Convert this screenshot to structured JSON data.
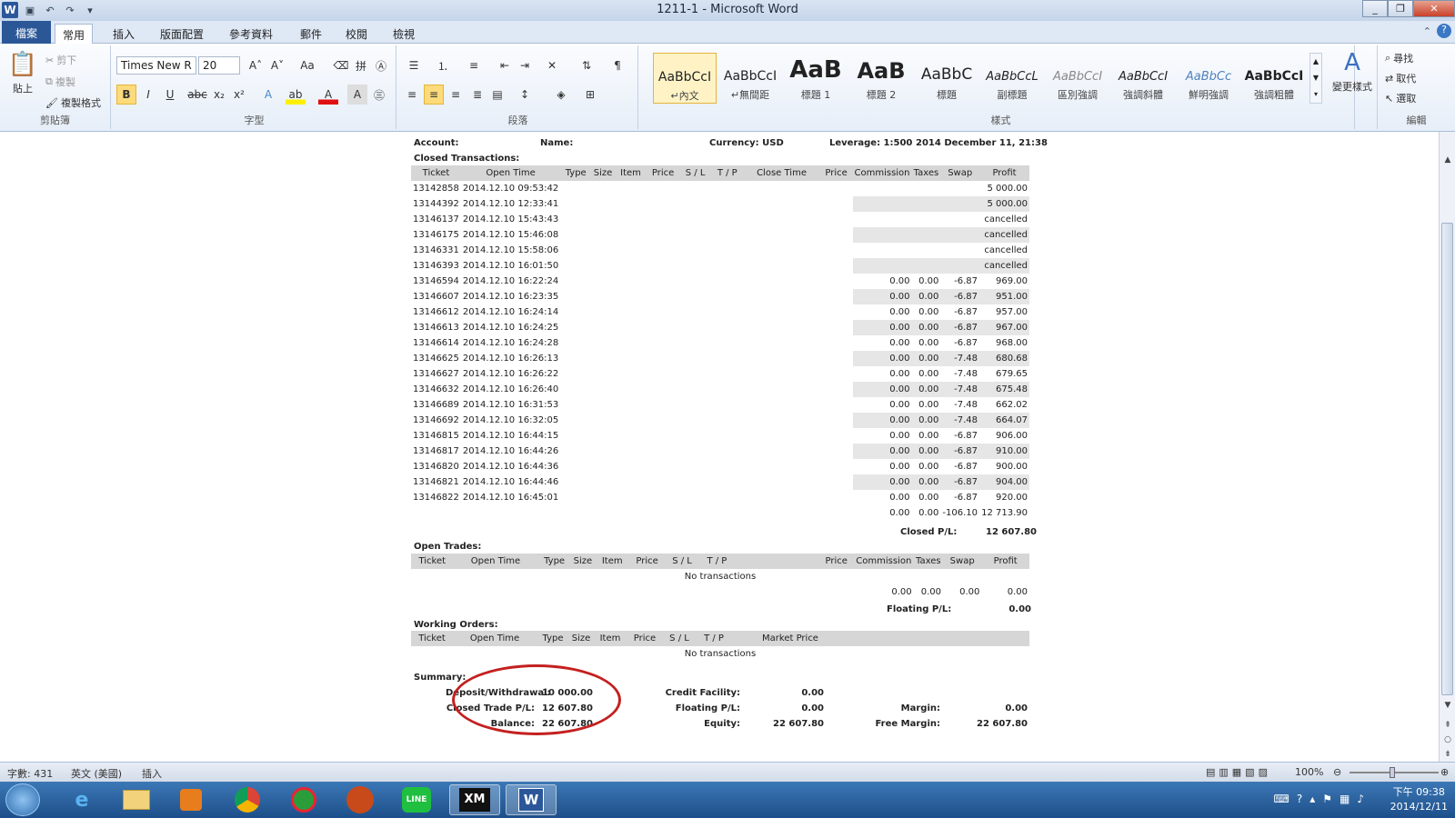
{
  "window": {
    "title": "1211-1 - Microsoft Word"
  },
  "tabs": [
    "檔案",
    "常用",
    "插入",
    "版面配置",
    "參考資料",
    "郵件",
    "校閱",
    "檢視"
  ],
  "ribbon": {
    "clipboard": {
      "paste": "貼上",
      "cut": "剪下",
      "copy": "複製",
      "format_painter": "複製格式",
      "label": "剪貼簿"
    },
    "font": {
      "name": "Times New R",
      "size": "20",
      "label": "字型",
      "aa": "Aa"
    },
    "paragraph": {
      "label": "段落"
    },
    "styles": {
      "label": "樣式",
      "items": [
        {
          "sample": "AaBbCcI",
          "name": "↵內文"
        },
        {
          "sample": "AaBbCcI",
          "name": "↵無間距"
        },
        {
          "sample": "AaB",
          "name": "標題 1"
        },
        {
          "sample": "AaB",
          "name": "標題 2"
        },
        {
          "sample": "AaBbC",
          "name": "標題"
        },
        {
          "sample": "AaBbCcL",
          "name": "副標題"
        },
        {
          "sample": "AaBbCcI",
          "name": "區別強調"
        },
        {
          "sample": "AaBbCcI",
          "name": "強調斜體"
        },
        {
          "sample": "AaBbCc",
          "name": "鮮明強調"
        },
        {
          "sample": "AaBbCcI",
          "name": "強調粗體"
        }
      ],
      "change": "變更樣式"
    },
    "editing": {
      "find": "尋找",
      "replace": "取代",
      "select": "選取",
      "label": "編輯"
    }
  },
  "doc": {
    "account": "Account:",
    "name": "Name:",
    "currency": "Currency: USD",
    "leverage": "Leverage: 1:500",
    "date": "2014 December 11, 21:38",
    "closed_title": "Closed Transactions:",
    "open_title": "Open Trades:",
    "working_title": "Working Orders:",
    "summary_title": "Summary:",
    "headers": [
      "Ticket",
      "Open Time",
      "Type",
      "Size",
      "Item",
      "Price",
      "S / L",
      "T / P",
      "Close Time",
      "Price",
      "Commission",
      "Taxes",
      "Swap",
      "Profit"
    ],
    "closed_rows": [
      [
        "13142858",
        "2014.12.10 09:53:42",
        "",
        "",
        "",
        "5 000.00"
      ],
      [
        "13144392",
        "2014.12.10 12:33:41",
        "",
        "",
        "",
        "5 000.00"
      ],
      [
        "13146137",
        "2014.12.10 15:43:43",
        "",
        "",
        "",
        "cancelled"
      ],
      [
        "13146175",
        "2014.12.10 15:46:08",
        "",
        "",
        "",
        "cancelled"
      ],
      [
        "13146331",
        "2014.12.10 15:58:06",
        "",
        "",
        "",
        "cancelled"
      ],
      [
        "13146393",
        "2014.12.10 16:01:50",
        "",
        "",
        "",
        "cancelled"
      ],
      [
        "13146594",
        "2014.12.10 16:22:24",
        "0.00",
        "0.00",
        "-6.87",
        "969.00"
      ],
      [
        "13146607",
        "2014.12.10 16:23:35",
        "0.00",
        "0.00",
        "-6.87",
        "951.00"
      ],
      [
        "13146612",
        "2014.12.10 16:24:14",
        "0.00",
        "0.00",
        "-6.87",
        "957.00"
      ],
      [
        "13146613",
        "2014.12.10 16:24:25",
        "0.00",
        "0.00",
        "-6.87",
        "967.00"
      ],
      [
        "13146614",
        "2014.12.10 16:24:28",
        "0.00",
        "0.00",
        "-6.87",
        "968.00"
      ],
      [
        "13146625",
        "2014.12.10 16:26:13",
        "0.00",
        "0.00",
        "-7.48",
        "680.68"
      ],
      [
        "13146627",
        "2014.12.10 16:26:22",
        "0.00",
        "0.00",
        "-7.48",
        "679.65"
      ],
      [
        "13146632",
        "2014.12.10 16:26:40",
        "0.00",
        "0.00",
        "-7.48",
        "675.48"
      ],
      [
        "13146689",
        "2014.12.10 16:31:53",
        "0.00",
        "0.00",
        "-7.48",
        "662.02"
      ],
      [
        "13146692",
        "2014.12.10 16:32:05",
        "0.00",
        "0.00",
        "-7.48",
        "664.07"
      ],
      [
        "13146815",
        "2014.12.10 16:44:15",
        "0.00",
        "0.00",
        "-6.87",
        "906.00"
      ],
      [
        "13146817",
        "2014.12.10 16:44:26",
        "0.00",
        "0.00",
        "-6.87",
        "910.00"
      ],
      [
        "13146820",
        "2014.12.10 16:44:36",
        "0.00",
        "0.00",
        "-6.87",
        "900.00"
      ],
      [
        "13146821",
        "2014.12.10 16:44:46",
        "0.00",
        "0.00",
        "-6.87",
        "904.00"
      ],
      [
        "13146822",
        "2014.12.10 16:45:01",
        "0.00",
        "0.00",
        "-6.87",
        "920.00"
      ]
    ],
    "closed_total": [
      "0.00",
      "0.00",
      "-106.10",
      "12 713.90"
    ],
    "closed_pl_label": "Closed P/L:",
    "closed_pl": "12 607.80",
    "no_tx": "No transactions",
    "open_total": [
      "0.00",
      "0.00",
      "0.00",
      "0.00"
    ],
    "floating_label": "Floating P/L:",
    "floating": "0.00",
    "market_price": "Market Price",
    "summary": {
      "deposit_label": "Deposit/Withdrawal:",
      "deposit": "10 000.00",
      "ctpl_label": "Closed Trade P/L:",
      "ctpl": "12 607.80",
      "balance_label": "Balance:",
      "balance": "22 607.80",
      "credit_label": "Credit Facility:",
      "credit": "0.00",
      "fpl_label": "Floating P/L:",
      "fpl": "0.00",
      "equity_label": "Equity:",
      "equity": "22 607.80",
      "margin_label": "Margin:",
      "margin": "0.00",
      "free_label": "Free Margin:",
      "free": "22 607.80"
    }
  },
  "status": {
    "words": "字數: 431",
    "lang": "英文 (美國)",
    "mode": "插入",
    "zoom": "100%"
  },
  "taskbar": {
    "apps": [
      "e",
      "",
      "",
      "",
      "",
      "",
      "LINE",
      "XM",
      "W"
    ],
    "time": "下午 09:38",
    "date": "2014/12/11"
  }
}
